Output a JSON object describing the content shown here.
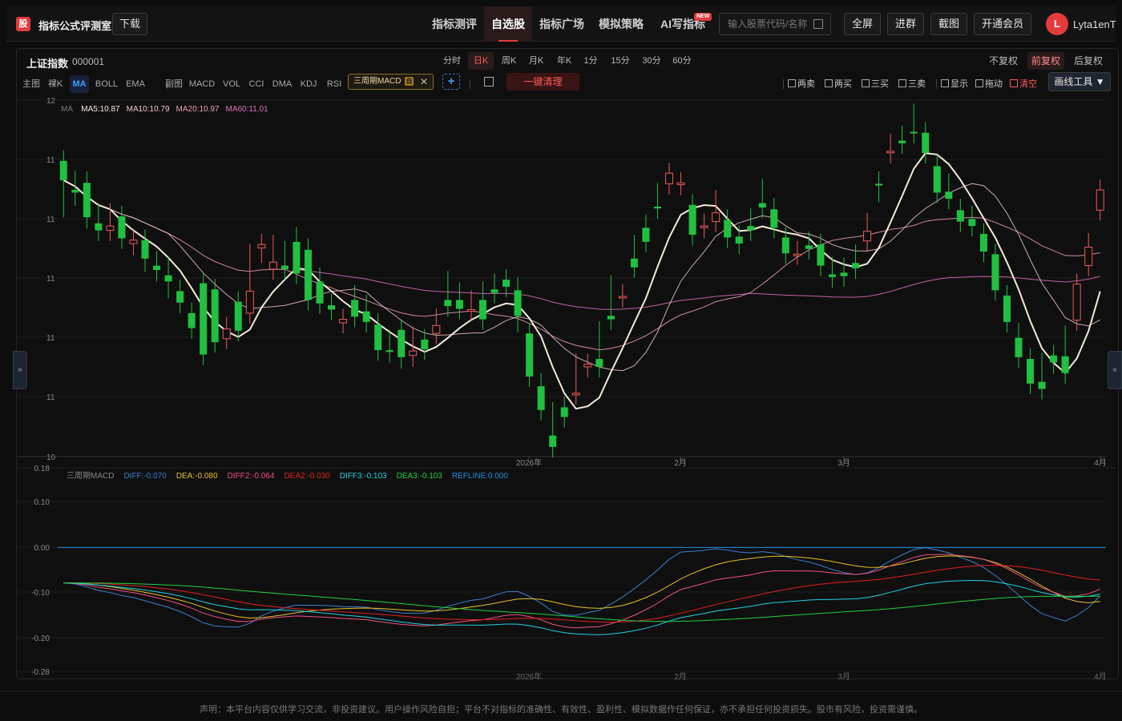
{
  "header": {
    "logo_char": "股",
    "app_title": "指标公式评测室",
    "download": "下载",
    "nav": [
      "指标测评",
      "自选股",
      "指标广场",
      "模拟策略",
      "AI写指标"
    ],
    "nav_active": 1,
    "new_badge": "NEW",
    "search_placeholder": "输入股票代码/名称",
    "buttons": [
      "全屏",
      "进群",
      "截图",
      "开通会员"
    ],
    "avatar_letter": "L",
    "username": "Lyta1enT"
  },
  "stock": {
    "name": "上证指数",
    "code": "000001"
  },
  "periods": [
    "分时",
    "日K",
    "周K",
    "月K",
    "年K",
    "1分",
    "15分",
    "30分",
    "60分"
  ],
  "period_active": 1,
  "adjust": [
    "不复权",
    "前复权",
    "后复权"
  ],
  "adjust_active": 1,
  "indicators": {
    "main_label": "主图",
    "naked_label": "裸K",
    "main": [
      "MA",
      "BOLL",
      "EMA"
    ],
    "main_active": 0,
    "sub_label": "副图",
    "sub": [
      "MACD",
      "VOL",
      "CCI",
      "DMA",
      "KDJ",
      "RSI"
    ],
    "custom_tag": "三周期MACD",
    "custom_badge": "自",
    "clear_all": "一键清理"
  },
  "signals": [
    "两卖",
    "两买",
    "三买",
    "三卖",
    "显示",
    "拖动",
    "清空"
  ],
  "draw_tools": "画线工具",
  "icons": {
    "search": "search-icon",
    "image": "image-icon",
    "close": "close-icon",
    "add": "plus-icon",
    "dropdown": "caret-down-icon"
  },
  "side_handles": {
    "left": "»",
    "right": "«"
  },
  "colors": {
    "up": "#f05a5a",
    "down": "#20c040",
    "ma5": "#f5ead8",
    "ma10": "#f0c8c8",
    "ma20": "#f0a0b0",
    "ma60": "#e070c0",
    "accent": "#e23b3b"
  },
  "chart_data": [
    {
      "type": "candlestick",
      "legend_prefix": "MA",
      "legend": [
        {
          "name": "MA5",
          "value": "10.87",
          "color": "#f5ead8"
        },
        {
          "name": "MA10",
          "value": "10.79",
          "color": "#f0c8c8"
        },
        {
          "name": "MA20",
          "value": "10.97",
          "color": "#f0a0b0"
        },
        {
          "name": "MA60",
          "value": "11.01",
          "color": "#e070c0"
        }
      ],
      "y_ticks": [
        "12",
        "11",
        "11",
        "11",
        "11",
        "11",
        "10"
      ],
      "x_ticks": [
        "2026年",
        "2月",
        "3月",
        "4月"
      ],
      "ohlc": [
        [
          11.96,
          11.94,
          11.44,
          11.74
        ],
        [
          11.63,
          11.73,
          11.57,
          11.6
        ],
        [
          11.71,
          11.72,
          11.31,
          11.32
        ],
        [
          11.25,
          11.36,
          11.22,
          11.17
        ],
        [
          11.17,
          11.36,
          11.17,
          11.22
        ],
        [
          11.33,
          11.33,
          11.1,
          11.08
        ],
        [
          11.02,
          11.07,
          11.01,
          11.06
        ],
        [
          11.06,
          11.04,
          10.82,
          10.85
        ],
        [
          10.77,
          10.81,
          10.71,
          10.72
        ],
        [
          10.66,
          10.76,
          10.52,
          10.59
        ],
        [
          10.48,
          10.49,
          10.42,
          10.35
        ],
        [
          10.23,
          10.16,
          10.17,
          10.06
        ],
        [
          10.57,
          10.42,
          10.23,
          9.76
        ],
        [
          10.5,
          10.5,
          10.04,
          9.9
        ],
        [
          9.94,
          9.94,
          10.07,
          10.05
        ],
        [
          10.36,
          10.36,
          10.12,
          10.03
        ],
        [
          10.23,
          10.25,
          10.9,
          10.48
        ],
        [
          10.97,
          10.97,
          10.92,
          11.01
        ],
        [
          10.73,
          10.75,
          11.0,
          10.81
        ],
        [
          10.77,
          10.85,
          10.93,
          10.73
        ],
        [
          11.04,
          11.09,
          10.71,
          10.68
        ],
        [
          10.95,
          10.96,
          10.53,
          10.38
        ],
        [
          10.59,
          10.63,
          10.35,
          10.34
        ],
        [
          10.32,
          10.33,
          10.28,
          10.27
        ],
        [
          10.12,
          10.16,
          10.12,
          10.16
        ],
        [
          10.38,
          10.43,
          10.28,
          10.19
        ],
        [
          10.25,
          10.32,
          10.31,
          10.13
        ],
        [
          10.1,
          10.11,
          9.95,
          9.81
        ],
        [
          9.81,
          9.81,
          9.92,
          9.79
        ],
        [
          10.04,
          10.04,
          9.72,
          9.73
        ],
        [
          9.75,
          9.74,
          9.96,
          9.8
        ],
        [
          9.93,
          9.93,
          9.88,
          9.82
        ],
        [
          10.0,
          10.0,
          10.16,
          10.09
        ],
        [
          10.38,
          10.47,
          10.59,
          10.31
        ],
        [
          10.38,
          10.38,
          10.46,
          10.28
        ],
        [
          10.27,
          10.3,
          10.37,
          10.27
        ],
        [
          10.38,
          10.39,
          10.47,
          10.16
        ],
        [
          10.5,
          10.52,
          10.56,
          10.46
        ],
        [
          10.61,
          10.61,
          10.55,
          10.53
        ],
        [
          10.49,
          10.52,
          10.13,
          10.2
        ],
        [
          10.0,
          10.0,
          9.58,
          9.51
        ],
        [
          9.4,
          9.42,
          9.43,
          9.13
        ],
        [
          8.84,
          8.84,
          9.1,
          8.71
        ],
        [
          9.16,
          9.16,
          9.07,
          9.05
        ],
        [
          9.31,
          9.32,
          9.65,
          9.32
        ],
        [
          9.62,
          9.63,
          9.65,
          9.65
        ],
        [
          9.71,
          9.71,
          10.02,
          9.62
        ],
        [
          10.2,
          10.3,
          10.54,
          10.16
        ],
        [
          10.41,
          10.41,
          10.44,
          10.42
        ],
        [
          10.85,
          10.95,
          11.0,
          10.75
        ],
        [
          11.2,
          11.23,
          11.12,
          11.04
        ],
        [
          11.44,
          11.47,
          11.59,
          11.42
        ],
        [
          11.7,
          11.78,
          11.75,
          11.82
        ],
        [
          11.69,
          11.71,
          11.69,
          11.71
        ],
        [
          11.46,
          11.43,
          11.25,
          11.12
        ],
        [
          11.22,
          11.2,
          11.24,
          11.22
        ],
        [
          11.27,
          11.35,
          11.51,
          11.37
        ],
        [
          11.29,
          11.28,
          11.12,
          11.09
        ],
        [
          11.1,
          11.08,
          11.04,
          11.02
        ],
        [
          11.22,
          11.25,
          11.3,
          11.17
        ],
        [
          11.48,
          11.5,
          11.64,
          11.43
        ],
        [
          11.41,
          11.42,
          11.24,
          11.2
        ],
        [
          11.09,
          11.09,
          10.99,
          10.91
        ],
        [
          10.9,
          10.9,
          10.93,
          10.9
        ],
        [
          11.0,
          11.0,
          11.04,
          10.96
        ],
        [
          11.01,
          11.0,
          10.77,
          10.77
        ],
        [
          10.67,
          10.67,
          10.75,
          10.64
        ],
        [
          10.69,
          10.71,
          10.74,
          10.65
        ],
        [
          10.8,
          10.8,
          10.89,
          10.74
        ],
        [
          11.05,
          11.24,
          11.25,
          11.16
        ],
        [
          11.7,
          11.72,
          11.61,
          11.68
        ],
        [
          12.07,
          12.15,
          12.05,
          12.07
        ],
        [
          12.19,
          12.2,
          12.24,
          12.16
        ],
        [
          12.29,
          12.35,
          12.49,
          12.28
        ],
        [
          12.28,
          12.27,
          12.1,
          12.05
        ],
        [
          11.9,
          11.91,
          11.69,
          11.6
        ],
        [
          11.61,
          11.7,
          11.55,
          11.53
        ],
        [
          11.4,
          11.41,
          11.34,
          11.27
        ],
        [
          11.3,
          11.33,
          11.29,
          11.22
        ],
        [
          11.13,
          11.13,
          10.95,
          10.93
        ],
        [
          10.9,
          10.9,
          10.69,
          10.49
        ],
        [
          10.43,
          10.43,
          10.33,
          10.13
        ],
        [
          9.95,
          9.96,
          10.0,
          9.73
        ],
        [
          9.71,
          9.71,
          9.6,
          9.43
        ],
        [
          9.45,
          9.45,
          9.66,
          9.37
        ],
        [
          9.75,
          9.75,
          9.66,
          9.67
        ],
        [
          9.74,
          9.74,
          9.97,
          9.55
        ],
        [
          10.15,
          10.15,
          10.54,
          10.56
        ],
        [
          10.77,
          10.79,
          11.02,
          10.98
        ],
        [
          11.4,
          11.41,
          11.5,
          11.63
        ]
      ]
    },
    {
      "type": "line",
      "title": "三周期MACD",
      "legend": [
        {
          "name": "DIFF",
          "value": "-0.070",
          "color": "#3a7fd0"
        },
        {
          "name": "DEA",
          "value": "-0.080",
          "color": "#e8c020"
        },
        {
          "name": "DIFF2",
          "value": "-0.064",
          "color": "#f05080"
        },
        {
          "name": "DEA2",
          "value": "-0.030",
          "color": "#e02020"
        },
        {
          "name": "DIFF3",
          "value": "-0.103",
          "color": "#20d0e0"
        },
        {
          "name": "DEA3",
          "value": "-0.103",
          "color": "#20d040"
        },
        {
          "name": "REFLINE",
          "value": "0.000",
          "color": "#2090e0"
        }
      ],
      "y_ticks": [
        "0.18",
        "0.10",
        "0.00",
        "-0.10",
        "-0.20",
        "-0.28"
      ],
      "x_ticks": [
        "2026年",
        "2月",
        "3月",
        "4月"
      ]
    }
  ],
  "footer": "声明：本平台内容仅供学习交流，非投资建议。用户操作风险自担；平台不对指标的准确性、有效性、盈利性、模拟数据作任何保证，亦不承担任何投资损失。股市有风险，投资需谨慎。"
}
